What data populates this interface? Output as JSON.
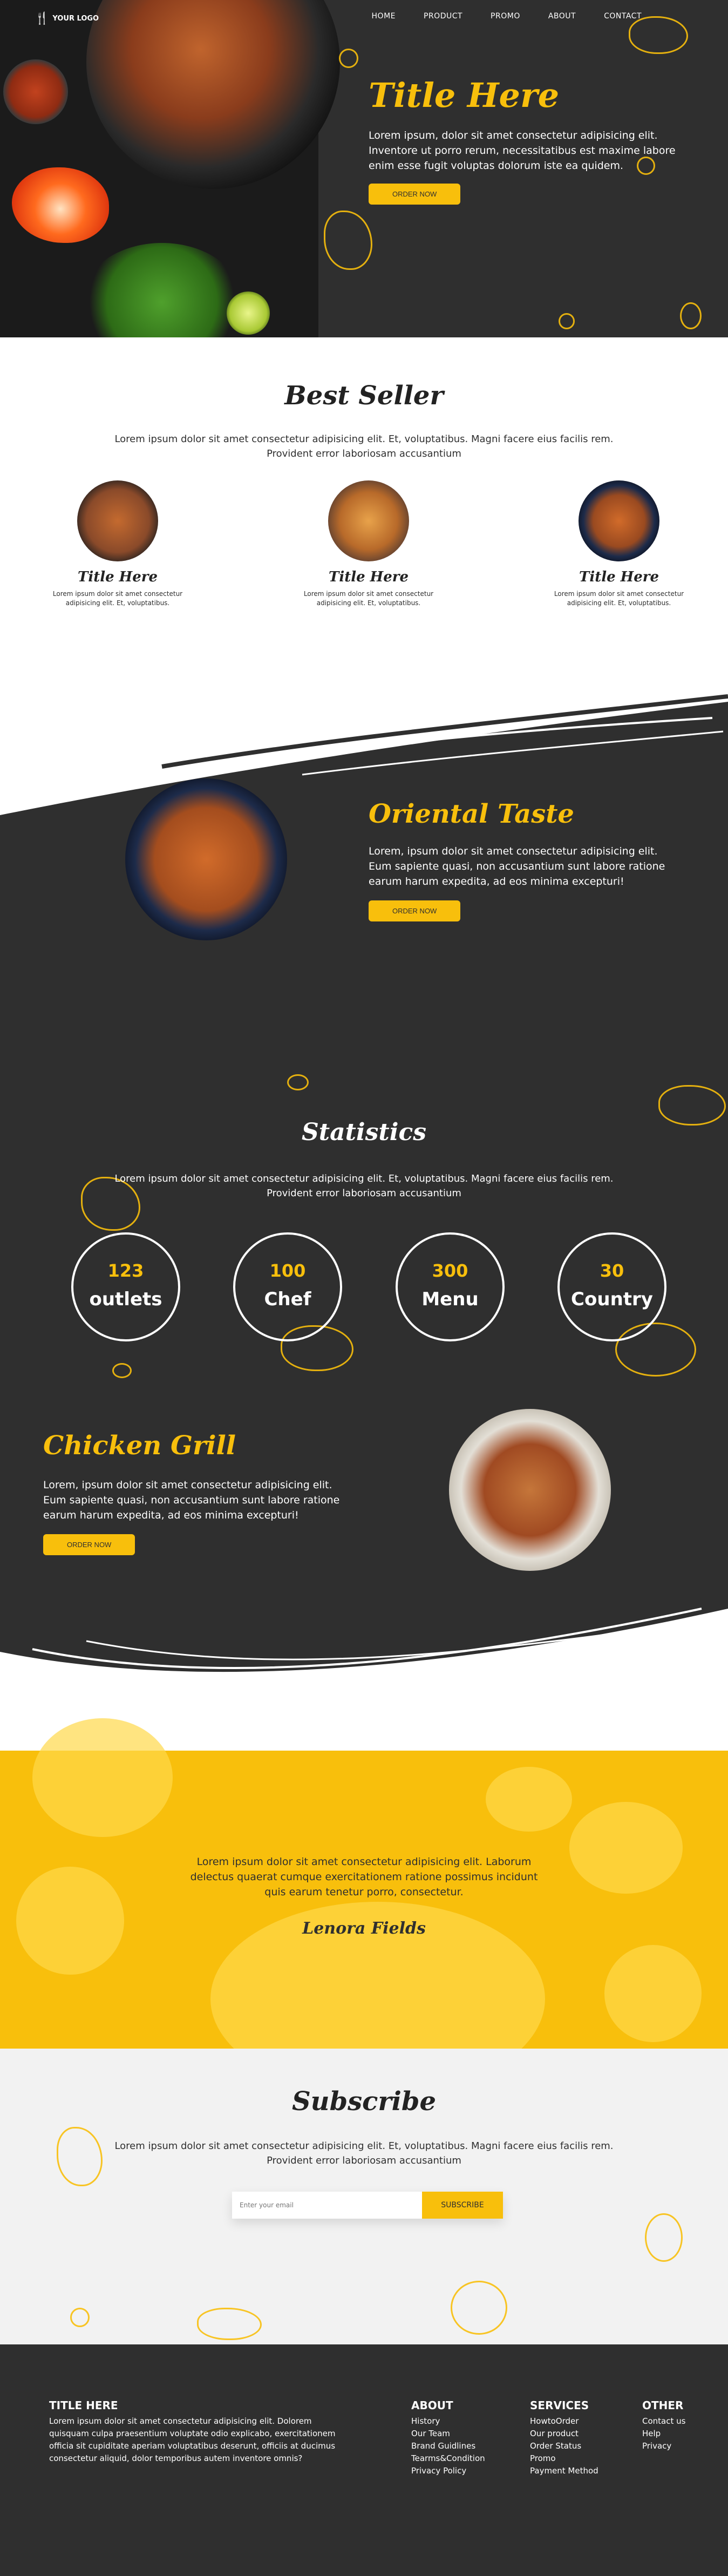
{
  "nav": {
    "logo": "YOUR LOGO",
    "items": [
      "HOME",
      "PRODUCT",
      "PROMO",
      "ABOUT",
      "CONTACT"
    ]
  },
  "hero": {
    "title": "Title Here",
    "text": "Lorem ipsum, dolor sit amet consectetur adipisicing elit. Inventore ut porro rerum, necessitatibus est maxime labore enim esse fugit voluptas dolorum iste ea quidem.",
    "button": "ORDER NOW"
  },
  "best_seller": {
    "title": "Best Seller",
    "subtitle": "Lorem ipsum dolor sit amet consectetur adipisicing elit. Et, voluptatibus. Magni facere eius facilis rem. Provident error laboriosam accusantium",
    "products": [
      {
        "title": "Title Here",
        "text": "Lorem ipsum dolor sit amet consectetur adipisicing elit. Et, voluptatibus."
      },
      {
        "title": "Title Here",
        "text": "Lorem ipsum dolor sit amet consectetur adipisicing elit. Et, voluptatibus."
      },
      {
        "title": "Title Here",
        "text": "Lorem ipsum dolor sit amet consectetur adipisicing elit. Et, voluptatibus."
      }
    ]
  },
  "oriental": {
    "title": "Oriental Taste",
    "text": "Lorem, ipsum dolor sit amet consectetur adipisicing elit. Eum sapiente quasi, non accusantium sunt labore ratione earum harum expedita, ad eos minima excepturi!",
    "button": "ORDER NOW"
  },
  "statistics": {
    "title": "Statistics",
    "subtitle": "Lorem ipsum dolor sit amet consectetur adipisicing elit. Et, voluptatibus. Magni facere eius facilis rem. Provident error laboriosam accusantium",
    "items": [
      {
        "value": "123",
        "label": "outlets"
      },
      {
        "value": "100",
        "label": "Chef"
      },
      {
        "value": "300",
        "label": "Menu"
      },
      {
        "value": "30",
        "label": "Country"
      }
    ]
  },
  "chicken": {
    "title": "Chicken Grill",
    "text": "Lorem, ipsum dolor sit amet consectetur adipisicing elit. Eum sapiente quasi, non accusantium sunt labore ratione earum harum expedita, ad eos minima excepturi!",
    "button": "ORDER NOW"
  },
  "testimonial": {
    "text": "Lorem ipsum dolor sit amet consectetur adipisicing elit. Laborum delectus quaerat cumque exercitationem ratione possimus incidunt quis earum tenetur porro, consectetur.",
    "name": "Lenora Fields"
  },
  "subscribe": {
    "title": "Subscribe",
    "subtitle": "Lorem ipsum dolor sit amet consectetur adipisicing elit. Et, voluptatibus. Magni facere eius facilis rem. Provident error laboriosam accusantium",
    "placeholder": "Enter your email",
    "button": "SUBSCRIBE"
  },
  "footer": {
    "about_title": "TITLE HERE",
    "about_text": "Lorem ipsum dolor sit amet consectetur adipisicing elit. Dolorem quisquam culpa praesentium voluptate odio explicabo, exercitationem officia sit cupiditate aperiam voluptatibus deserunt, officiis at ducimus consectetur aliquid, dolor temporibus autem inventore omnis?",
    "columns": [
      {
        "title": "ABOUT",
        "items": [
          "History",
          "Our Team",
          "Brand Guidlines",
          "Tearms&Condition",
          "Privacy Policy"
        ]
      },
      {
        "title": "SERVICES",
        "items": [
          "HowtoOrder",
          "Our product",
          "Order Status",
          "Promo",
          "Payment Method"
        ]
      },
      {
        "title": "OTHER",
        "items": [
          "Contact us",
          "Help",
          "Privacy"
        ]
      }
    ]
  },
  "colors": {
    "accent": "#f8bf0c",
    "dark": "#2f2f2f",
    "light": "#f2f2f2"
  }
}
